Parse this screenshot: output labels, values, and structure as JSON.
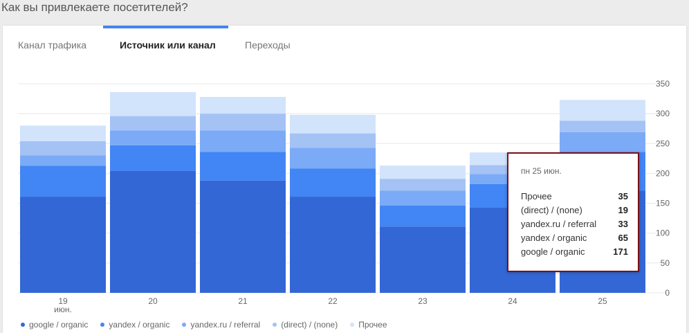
{
  "page_title": "Как вы привлекаете посетителей?",
  "tabs": [
    {
      "label": "Канал трафика",
      "active": false
    },
    {
      "label": "Источник или канал",
      "active": true
    },
    {
      "label": "Переходы",
      "active": false
    }
  ],
  "colors": {
    "accent": "#4285f4",
    "series": [
      "#3367d6",
      "#4285f4",
      "#7baaf7",
      "#a4c2f4",
      "#d2e3fc"
    ]
  },
  "chart_data": {
    "type": "bar",
    "stacked": true,
    "categories": [
      "19",
      "20",
      "21",
      "22",
      "23",
      "24",
      "25"
    ],
    "category_sublabels": [
      "июн.",
      "",
      "",
      "",
      "",
      "",
      ""
    ],
    "series": [
      {
        "name": "google / organic",
        "values": [
          161,
          204,
          188,
          161,
          111,
          143,
          171
        ]
      },
      {
        "name": "yandex / organic",
        "values": [
          52,
          43,
          48,
          47,
          35,
          39,
          65
        ]
      },
      {
        "name": "yandex.ru / referral",
        "values": [
          17,
          25,
          36,
          35,
          25,
          17,
          33
        ]
      },
      {
        "name": "(direct) / (none)",
        "values": [
          24,
          24,
          28,
          24,
          20,
          15,
          19
        ]
      },
      {
        "name": "Прочее",
        "values": [
          26,
          40,
          28,
          31,
          22,
          21,
          35
        ]
      }
    ],
    "yticks": [
      0,
      50,
      100,
      150,
      200,
      250,
      300,
      350
    ],
    "ylim": [
      0,
      350
    ],
    "grid": true,
    "legend": "bottom"
  },
  "tooltip": {
    "date": "пн 25 июн.",
    "rows": [
      {
        "label": "Прочее",
        "value": "35"
      },
      {
        "label": "(direct) / (none)",
        "value": "19"
      },
      {
        "label": "yandex.ru / referral",
        "value": "33"
      },
      {
        "label": "yandex / organic",
        "value": "65"
      },
      {
        "label": "google / organic",
        "value": "171"
      }
    ]
  }
}
